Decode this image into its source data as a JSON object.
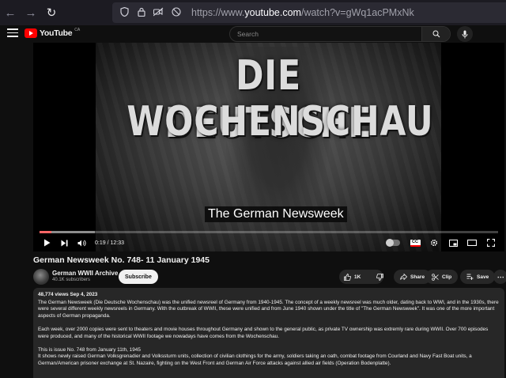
{
  "browser": {
    "url_prefix": "https://www.",
    "url_domain": "youtube.com",
    "url_path": "/watch?v=gWq1acPMxNk"
  },
  "header": {
    "logo_text": "YouTube",
    "logo_country": "CA",
    "search_placeholder": "Search"
  },
  "player": {
    "frame_title_line1": "DIE DEUTSCHE",
    "frame_title_line2": "WOCHENSCHAU",
    "subtitle": "The German Newsweek",
    "time_display": "0:19 / 12:33",
    "progress_fraction": 0.025,
    "buffer_fraction": 0.12,
    "cc_label": "CC"
  },
  "video": {
    "title": "German Newsweek No. 748- 11 January 1945",
    "channel_name": "German WWII Archive",
    "subscribers": "40.1K subscribers",
    "subscribe_label": "Subscribe",
    "likes": "1K",
    "share_label": "Share",
    "clip_label": "Clip",
    "save_label": "Save"
  },
  "description": {
    "meta": "48,774 views  Sep 4, 2023",
    "para1": "The German Newsweek (Die Deutsche Wochenschau) was the unified newsreel of Germany from 1940-1945. The concept of a weekly newsreel was much older, dating back to WWI, and in the 1930s, there were several different weekly newsreels in Germany. With the outbreak of WWII, these were unified and from June 1940 shown under the title of \"The German Newsweek\". It was one of the more important aspects of German propaganda.",
    "para2": "Each week, over 2000 copies were sent to theaters and movie houses throughout Germany and shown to the general public, as private TV ownership was extremly rare during WWII. Over 700 episodes were produced, and many of the historical WWII footage we nowadays have comes from the Wochenschau.",
    "para3a": "This is issue No. 748 from January 11th, 1945",
    "para3b": "It shows newly raised German Volksgrenadier and Volkssturm units, collection of civilian clothings for the army, soldiers taking an oath, combat footage from Courland and Navy Fast Boat units, a German/American prisoner exchange at St. Nazaire, fighting on the West Front and German Air Force attacks against allied air fields (Operation Bodenplatte)."
  },
  "colors": {
    "accent": "#ff0000",
    "background": "#0f0f0f",
    "surface": "#272727"
  }
}
